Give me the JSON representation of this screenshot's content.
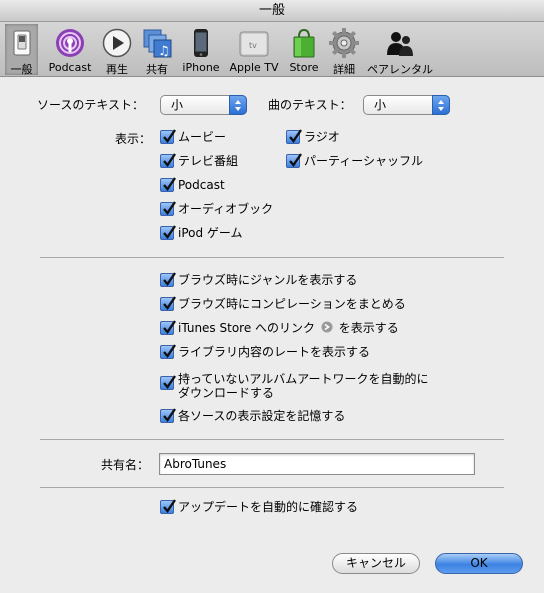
{
  "window": {
    "title": "一般"
  },
  "toolbar": {
    "items": [
      {
        "label": "一般",
        "icon": "general-switch-icon",
        "selected": true
      },
      {
        "label": "Podcast",
        "icon": "podcast-icon",
        "selected": false
      },
      {
        "label": "再生",
        "icon": "playback-icon",
        "selected": false
      },
      {
        "label": "共有",
        "icon": "sharing-icon",
        "selected": false
      },
      {
        "label": "iPhone",
        "icon": "iphone-icon",
        "selected": false
      },
      {
        "label": "Apple TV",
        "icon": "apple-tv-icon",
        "selected": false
      },
      {
        "label": "Store",
        "icon": "store-bag-icon",
        "selected": false
      },
      {
        "label": "詳細",
        "icon": "advanced-gear-icon",
        "selected": false
      },
      {
        "label": "ペアレンタル",
        "icon": "parental-icon",
        "selected": false
      }
    ]
  },
  "text_size": {
    "source_label": "ソースのテキスト：",
    "source_value": "小",
    "song_label": "曲のテキスト：",
    "song_value": "小"
  },
  "show": {
    "label": "表示：",
    "col1": [
      {
        "label": "ムービー",
        "checked": true
      },
      {
        "label": "テレビ番組",
        "checked": true
      },
      {
        "label": "Podcast",
        "checked": true
      },
      {
        "label": "オーディオブック",
        "checked": true
      },
      {
        "label": "iPod ゲーム",
        "checked": true
      }
    ],
    "col2": [
      {
        "label": "ラジオ",
        "checked": true
      },
      {
        "label": "パーティーシャッフル",
        "checked": true
      }
    ]
  },
  "options": {
    "browse_genre": "ブラウズ時にジャンルを表示する",
    "browse_compilation": "ブラウズ時にコンピレーションをまとめる",
    "store_links_pre": "iTunes Store へのリンク",
    "store_links_post": "を表示する",
    "library_rating": "ライブラリ内容のレートを表示する",
    "artwork_line1": "持っていないアルバムアートワークを自動的に",
    "artwork_line2": "ダウンロードする",
    "remember_view": "各ソースの表示設定を記憶する"
  },
  "shared_name": {
    "label": "共有名：",
    "value": "AbroTunes"
  },
  "updates": {
    "label": "アップデートを自動的に確認する"
  },
  "buttons": {
    "cancel": "キャンセル",
    "ok": "OK"
  },
  "colors": {
    "accent": "#3d83e3",
    "window_bg": "#ececec"
  }
}
